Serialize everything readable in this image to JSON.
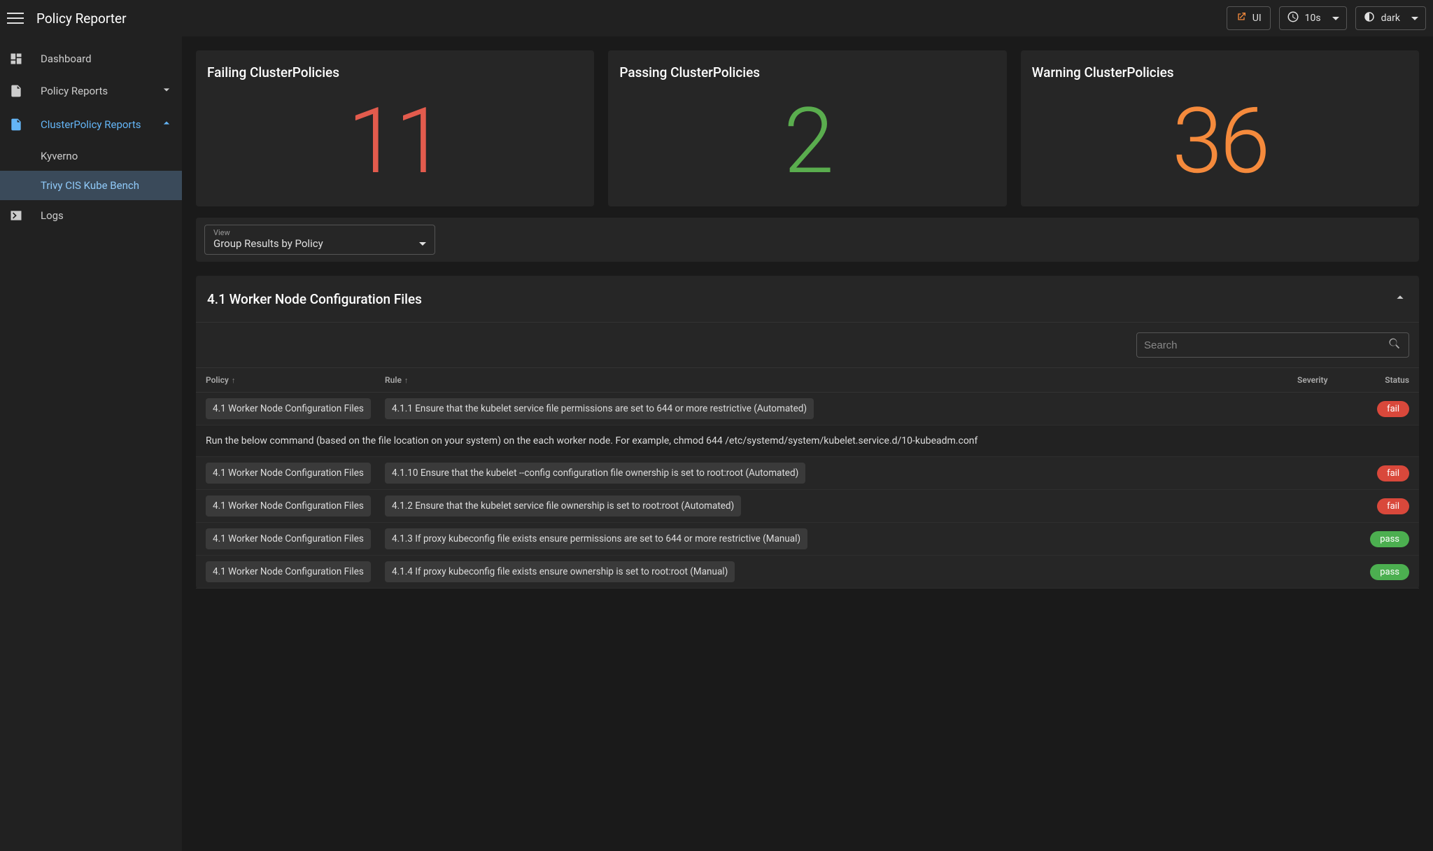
{
  "header": {
    "title": "Policy Reporter",
    "ui_label": "UI",
    "refresh_label": "10s",
    "theme_label": "dark"
  },
  "sidebar": {
    "dashboard": "Dashboard",
    "policy_reports": "Policy Reports",
    "cluster_policy_reports": "ClusterPolicy Reports",
    "kyverno": "Kyverno",
    "trivy": "Trivy CIS Kube Bench",
    "logs": "Logs"
  },
  "cards": {
    "fail_title": "Failing ClusterPolicies",
    "fail_value": "11",
    "pass_title": "Passing ClusterPolicies",
    "pass_value": "2",
    "warn_title": "Warning ClusterPolicies",
    "warn_value": "36"
  },
  "view": {
    "label": "View",
    "value": "Group Results by Policy"
  },
  "policy_panel": {
    "title": "4.1 Worker Node Configuration Files",
    "search_placeholder": "Search"
  },
  "columns": {
    "policy": "Policy",
    "rule": "Rule",
    "severity": "Severity",
    "status": "Status"
  },
  "rows": [
    {
      "policy": "4.1 Worker Node Configuration Files",
      "rule": "4.1.1 Ensure that the kubelet service file permissions are set to 644 or more restrictive (Automated)",
      "status": "fail",
      "expanded_detail": "Run the below command (based on the file location on your system) on the each worker node. For example, chmod 644 /etc/systemd/system/kubelet.service.d/10-kubeadm.conf"
    },
    {
      "policy": "4.1 Worker Node Configuration Files",
      "rule": "4.1.10 Ensure that the kubelet --config configuration file ownership is set to root:root (Automated)",
      "status": "fail"
    },
    {
      "policy": "4.1 Worker Node Configuration Files",
      "rule": "4.1.2 Ensure that the kubelet service file ownership is set to root:root (Automated)",
      "status": "fail"
    },
    {
      "policy": "4.1 Worker Node Configuration Files",
      "rule": "4.1.3 If proxy kubeconfig file exists ensure permissions are set to 644 or more restrictive (Manual)",
      "status": "pass"
    },
    {
      "policy": "4.1 Worker Node Configuration Files",
      "rule": "4.1.4 If proxy kubeconfig file exists ensure ownership is set to root:root (Manual)",
      "status": "pass"
    }
  ]
}
